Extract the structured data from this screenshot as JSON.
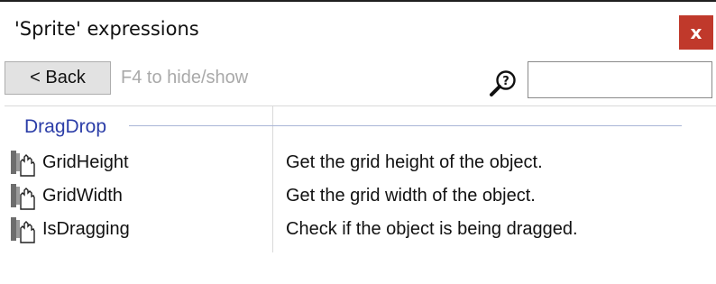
{
  "window": {
    "title": "'Sprite' expressions",
    "close_label": "x"
  },
  "toolbar": {
    "back_label": "< Back",
    "hint": "F4 to hide/show",
    "search": {
      "value": "",
      "placeholder": ""
    },
    "search_icon": "search-help-icon"
  },
  "list": {
    "group": "DragDrop",
    "items": [
      {
        "name": "GridHeight",
        "description": "Get the grid height of the object.",
        "icon": "drag-drop-hand-icon"
      },
      {
        "name": "GridWidth",
        "description": "Get the grid width of the object.",
        "icon": "drag-drop-hand-icon"
      },
      {
        "name": "IsDragging",
        "description": "Check if the object is being dragged.",
        "icon": "drag-drop-hand-icon"
      }
    ]
  },
  "colors": {
    "close_button": "#c0392b",
    "group_label": "#2c3ea8"
  }
}
